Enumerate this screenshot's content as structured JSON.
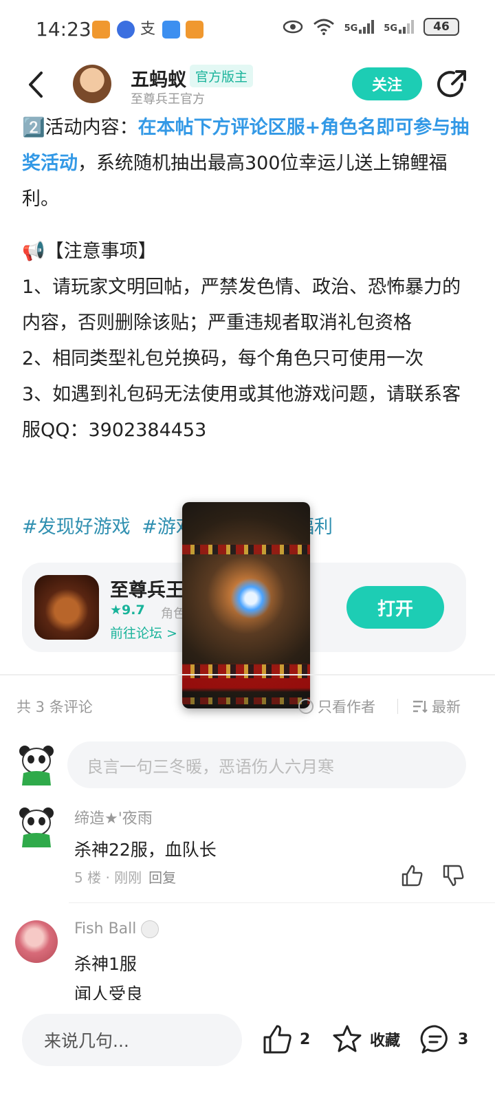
{
  "status_bar": {
    "time": "14:23",
    "network_1": "5G",
    "network_2": "5G",
    "battery": "46",
    "notif_icons": [
      "app-notification-icon",
      "app-notification-icon",
      "app-notification-icon",
      "app-notification-icon",
      "app-notification-icon"
    ]
  },
  "header": {
    "author_name": "五蚂蚁",
    "badge": "官方版主",
    "author_sub": "至尊兵王官方",
    "follow_label": "关注"
  },
  "post": {
    "line1_prefix": "2️⃣活动内容：",
    "line1_highlight": "在本帖下方评论区服+角色名即可参与抽奖活动",
    "line1_suffix": "，系统随机抽出最高300位幸运儿送上锦鲤福利。",
    "notice_title": "📢【注意事项】",
    "rule1": "1、请玩家文明回帖，严禁发色情、政治、恐怖暴力的内容，否则删除该贴；严重违规者取消礼包资格",
    "rule2": "2、相同类型礼包兑换码，每个角色只可使用一次",
    "rule3": "3、如遇到礼包码无法使用或其他游戏问题，请联系客服QQ：3902384453",
    "tags": [
      "#发现好游戏",
      "#游戏推荐",
      "#游戏福利"
    ]
  },
  "game_card": {
    "name": "至尊兵王",
    "rating": "★9.7",
    "category": "角色",
    "forum_link": "前往论坛 >",
    "open_label": "打开"
  },
  "comments_bar": {
    "count": "共 3 条评论",
    "author_only": "只看作者",
    "sort": "最新"
  },
  "comment_input": {
    "placeholder": "良言一句三冬暖，恶语伤人六月寒"
  },
  "comments": [
    {
      "user": "缔造★'夜雨",
      "text": "杀神22服，血队长",
      "floor": "5 楼 · 刚刚",
      "reply": "回复"
    },
    {
      "user": "Fish Ball",
      "text1": "杀神1服",
      "text2": "闻人受良"
    }
  ],
  "bottom_bar": {
    "input_placeholder": "来说几句...",
    "like_count": "2",
    "favorite_label": "收藏",
    "comment_count": "3"
  },
  "colors": {
    "accent": "#1dcdb4",
    "link_highlight": "#3399e6",
    "tag": "#2f8fb0"
  }
}
